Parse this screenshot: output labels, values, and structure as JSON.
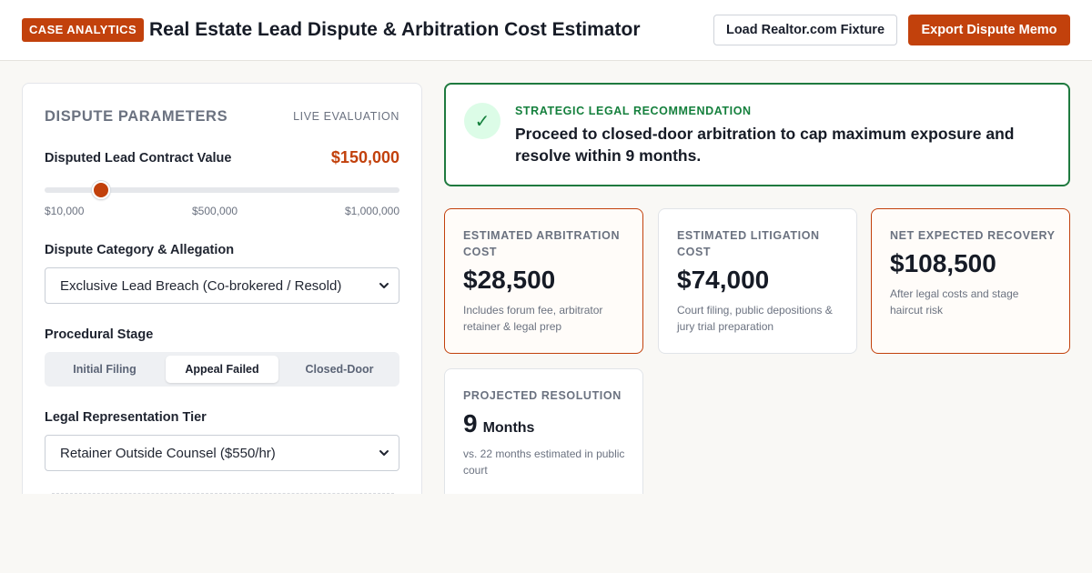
{
  "header": {
    "badge": "CASE ANALYTICS",
    "title": "Real Estate Lead Dispute & Arbitration Cost Estimator",
    "load_button": "Load Realtor.com Fixture",
    "export_button": "Export Dispute Memo"
  },
  "parameters": {
    "title": "DISPUTE PARAMETERS",
    "tag": "LIVE EVALUATION",
    "contract": {
      "label": "Disputed Lead Contract Value",
      "value": "$150,000",
      "slider_min": 10000,
      "slider_max": 1000000,
      "slider_value": 150000,
      "tick_labels": [
        "$10,000",
        "$500,000",
        "$1,000,000"
      ]
    },
    "category": {
      "label": "Dispute Category & Allegation",
      "selected": "Exclusive Lead Breach (Co-brokered / Resold)"
    },
    "stage": {
      "label": "Procedural Stage",
      "options": [
        "Initial Filing",
        "Appeal Failed",
        "Closed-Door"
      ],
      "selected_index": 1
    },
    "representation": {
      "label": "Legal Representation Tier",
      "selected": "Retainer Outside Counsel ($550/hr)"
    }
  },
  "recommendation": {
    "kicker": "STRATEGIC LEGAL RECOMMENDATION",
    "text": "Proceed to closed-door arbitration to cap maximum exposure and resolve within 9 months.",
    "icon": "check-icon"
  },
  "metrics": {
    "arbitration": {
      "label": "ESTIMATED ARBITRATION COST",
      "value": "$28,500",
      "note": "Includes forum fee, arbitrator retainer & legal prep"
    },
    "litigation": {
      "label": "ESTIMATED LITIGATION COST",
      "value": "$74,000",
      "note": "Court filing, public depositions & jury trial preparation"
    },
    "recovery": {
      "label": "NET EXPECTED RECOVERY",
      "value": "$108,500",
      "note": "After legal costs and stage haircut risk"
    },
    "resolution": {
      "label": "PROJECTED RESOLUTION",
      "value": "9",
      "unit": "Months",
      "note": "vs. 22 months estimated in public court"
    }
  },
  "colors": {
    "accent": "#c2410c",
    "success": "#15803d",
    "background": "#f9f8f5"
  }
}
